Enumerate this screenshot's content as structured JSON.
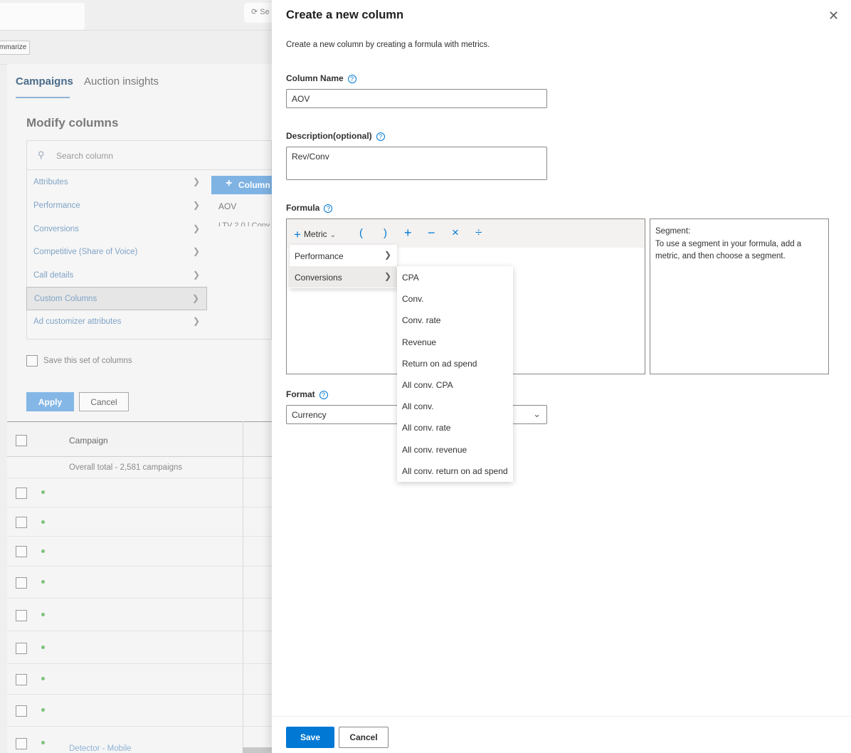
{
  "background": {
    "search_partial": "Se",
    "summarize_partial": "mmarize",
    "tabs": [
      "Campaigns",
      "Auction insights"
    ],
    "modify_title": "Modify columns",
    "search_placeholder": "Search column",
    "categories": [
      "Attributes",
      "Performance",
      "Conversions",
      "Competitive (Share of Voice)",
      "Call details",
      "Custom Columns",
      "Ad customizer attributes"
    ],
    "selected_category": "Custom Columns",
    "add_column_label": "Column",
    "custom_columns": [
      "AOV",
      "LTV 2.0 | Conv"
    ],
    "save_set_label": "Save this set of columns",
    "apply_label": "Apply",
    "cancel_label": "Cancel",
    "grid_header": "Campaign",
    "overall_total": "Overall total - 2,581 campaigns",
    "bottom_link_partial": "Detector - Mobile",
    "status_color": "#7dc27d"
  },
  "panel": {
    "title": "Create a new column",
    "description": "Create a new column by creating a formula with metrics.",
    "column_name_label": "Column Name",
    "column_name_value": "AOV",
    "description_label": "Description(optional)",
    "description_value": "Rev/Conv",
    "formula_label": "Formula",
    "metric_button_label": "Metric",
    "operators": [
      "(",
      ")",
      "+",
      "−",
      "×",
      "÷"
    ],
    "segment_title": "Segment:",
    "segment_help": "To use a segment in your formula, add a metric, and then choose a segment.",
    "format_label": "Format",
    "format_value": "Currency",
    "save_label": "Save",
    "cancel_label": "Cancel",
    "accent_color": "#0078d4"
  },
  "metric_menu": {
    "categories": [
      "Performance",
      "Conversions"
    ],
    "highlighted": "Conversions",
    "conversions_items": [
      "CPA",
      "Conv.",
      "Conv. rate",
      "Revenue",
      "Return on ad spend",
      "All conv. CPA",
      "All conv.",
      "All conv. rate",
      "All conv. revenue",
      "All conv. return on ad spend"
    ]
  }
}
